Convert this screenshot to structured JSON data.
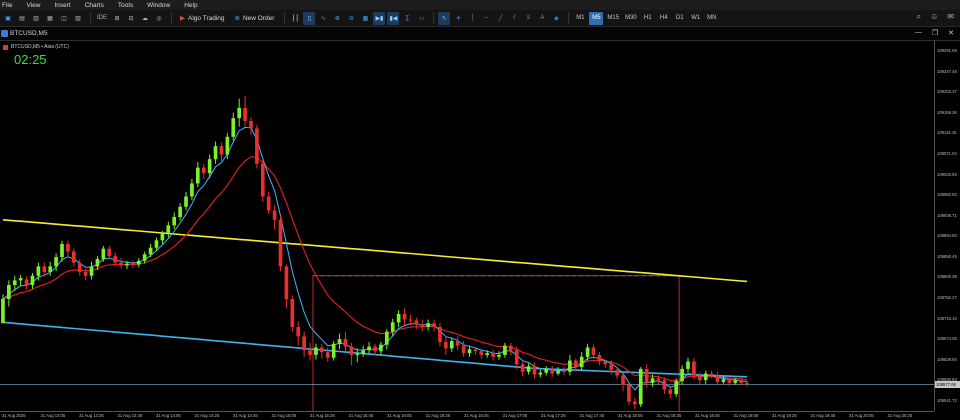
{
  "menu": [
    "File",
    "View",
    "Insert",
    "Charts",
    "Tools",
    "Window",
    "Help"
  ],
  "toolbar": {
    "algo_trading": "Algo Trading",
    "new_order": "New Order",
    "ide": "IDE",
    "timeframes": [
      "M1",
      "M5",
      "M15",
      "M30",
      "H1",
      "H4",
      "D1",
      "W1",
      "MN"
    ],
    "active_timeframe": "M5"
  },
  "chart": {
    "window_title": "BTCUSD,M5",
    "indicator_label": "BTCUSD,M5 ▪ Asia (UTC)",
    "countdown": "02:25",
    "colors": {
      "bull": "#7df02c",
      "bear": "#e8302f",
      "ma_fast": "#3fb5ff",
      "ma_mid": "#d91f1f",
      "ma_slow_yellow": "#f2ef32",
      "ma_slow_blue": "#3ab4ef",
      "box": "#c02a2a",
      "dashed": "#4d6d9a",
      "hline": "#8ab2d6"
    }
  },
  "chart_data": {
    "type": "candlestick",
    "symbol": "BTCUSD",
    "timeframe": "M5",
    "price_ticks": [
      "109291.59",
      "109247.48",
      "109203.37",
      "109159.26",
      "109115.15",
      "109071.04",
      "109026.93",
      "108982.82",
      "108938.71",
      "108894.60",
      "108850.49",
      "108806.38",
      "108762.27",
      "108718.16",
      "108674.05",
      "108629.94",
      "108585.83",
      "108541.72"
    ],
    "current_price": "108577.06",
    "time_ticks": [
      "31 Aug 2025",
      "31 Aug 13:05",
      "31 Aug 13:25",
      "31 Aug 13:45",
      "31 Aug 14:05",
      "31 Aug 14:25",
      "31 Aug 14:45",
      "31 Aug 15:05",
      "31 Aug 15:25",
      "31 Aug 15:45",
      "31 Aug 16:05",
      "31 Aug 16:25",
      "31 Aug 16:45",
      "31 Aug 17:05",
      "31 Aug 17:25",
      "31 Aug 17:45",
      "31 Aug 18:05",
      "31 Aug 18:25",
      "31 Aug 18:45",
      "31 Aug 19:05",
      "31 Aug 19:25",
      "31 Aug 19:45",
      "31 Aug 20:05",
      "31 Aug 20:25"
    ],
    "candles": [
      [
        108708,
        108760,
        108710,
        108770
      ],
      [
        108760,
        108790,
        108744,
        108800
      ],
      [
        108790,
        108800,
        108778,
        108810
      ],
      [
        108800,
        108805,
        108788,
        108812
      ],
      [
        108802,
        108790,
        108780,
        108808
      ],
      [
        108790,
        108810,
        108782,
        108816
      ],
      [
        108810,
        108830,
        108800,
        108838
      ],
      [
        108830,
        108818,
        108808,
        108838
      ],
      [
        108818,
        108830,
        108810,
        108840
      ],
      [
        108830,
        108850,
        108820,
        108858
      ],
      [
        108850,
        108878,
        108840,
        108885
      ],
      [
        108878,
        108862,
        108850,
        108885
      ],
      [
        108862,
        108838,
        108830,
        108868
      ],
      [
        108838,
        108818,
        108810,
        108845
      ],
      [
        108818,
        108810,
        108800,
        108825
      ],
      [
        108810,
        108830,
        108802,
        108840
      ],
      [
        108830,
        108846,
        108822,
        108852
      ],
      [
        108846,
        108868,
        108840,
        108874
      ],
      [
        108868,
        108852,
        108846,
        108874
      ],
      [
        108852,
        108838,
        108830,
        108860
      ],
      [
        108838,
        108832,
        108826,
        108848
      ],
      [
        108832,
        108836,
        108824,
        108842
      ],
      [
        108836,
        108834,
        108826,
        108842
      ],
      [
        108834,
        108842,
        108828,
        108848
      ],
      [
        108842,
        108856,
        108836,
        108862
      ],
      [
        108856,
        108870,
        108850,
        108878
      ],
      [
        108870,
        108886,
        108864,
        108892
      ],
      [
        108886,
        108900,
        108878,
        108906
      ],
      [
        108900,
        108918,
        108892,
        108926
      ],
      [
        108918,
        108936,
        108910,
        108946
      ],
      [
        108936,
        108958,
        108928,
        108966
      ],
      [
        108958,
        108980,
        108950,
        108990
      ],
      [
        108980,
        109008,
        108972,
        109018
      ],
      [
        109008,
        109042,
        109000,
        109054
      ],
      [
        109042,
        109030,
        109018,
        109050
      ],
      [
        109030,
        109060,
        109020,
        109070
      ],
      [
        109060,
        109088,
        109050,
        109098
      ],
      [
        109088,
        109070,
        109056,
        109096
      ],
      [
        109070,
        109108,
        109060,
        109116
      ],
      [
        109108,
        109148,
        109100,
        109160
      ],
      [
        109148,
        109170,
        109130,
        109190
      ],
      [
        109170,
        109142,
        109130,
        109196
      ],
      [
        109142,
        109126,
        109112,
        109150
      ],
      [
        109126,
        109050,
        109040,
        109134
      ],
      [
        109050,
        108980,
        108968,
        109058
      ],
      [
        108980,
        108950,
        108942,
        108990
      ],
      [
        108950,
        108930,
        108910,
        108962
      ],
      [
        108930,
        108830,
        108820,
        108938
      ],
      [
        108830,
        108760,
        108740,
        108834
      ],
      [
        108760,
        108700,
        108690,
        108768
      ],
      [
        108700,
        108680,
        108660,
        108712
      ],
      [
        108680,
        108650,
        108636,
        108690
      ],
      [
        108650,
        108640,
        108628,
        108666
      ],
      [
        108640,
        108656,
        108630,
        108664
      ],
      [
        108656,
        108646,
        108632,
        108664
      ],
      [
        108646,
        108634,
        108625,
        108656
      ],
      [
        108634,
        108664,
        108628,
        108670
      ],
      [
        108664,
        108674,
        108652,
        108686
      ],
      [
        108674,
        108658,
        108648,
        108690
      ],
      [
        108658,
        108640,
        108618,
        108666
      ],
      [
        108640,
        108642,
        108624,
        108654
      ],
      [
        108642,
        108650,
        108636,
        108660
      ],
      [
        108650,
        108658,
        108642,
        108668
      ],
      [
        108658,
        108648,
        108640,
        108664
      ],
      [
        108648,
        108662,
        108640,
        108668
      ],
      [
        108662,
        108690,
        108652,
        108696
      ],
      [
        108690,
        108710,
        108680,
        108718
      ],
      [
        108710,
        108728,
        108700,
        108736
      ],
      [
        108728,
        108716,
        108704,
        108740
      ],
      [
        108716,
        108714,
        108704,
        108726
      ],
      [
        108714,
        108706,
        108696,
        108720
      ],
      [
        108706,
        108700,
        108690,
        108716
      ],
      [
        108700,
        108708,
        108692,
        108716
      ],
      [
        108708,
        108700,
        108690,
        108716
      ],
      [
        108700,
        108668,
        108658,
        108708
      ],
      [
        108668,
        108654,
        108640,
        108680
      ],
      [
        108654,
        108670,
        108646,
        108676
      ],
      [
        108670,
        108660,
        108650,
        108680
      ],
      [
        108660,
        108644,
        108636,
        108670
      ],
      [
        108644,
        108652,
        108636,
        108660
      ],
      [
        108652,
        108648,
        108640,
        108656
      ],
      [
        108648,
        108640,
        108632,
        108654
      ],
      [
        108640,
        108644,
        108634,
        108650
      ],
      [
        108644,
        108636,
        108628,
        108652
      ],
      [
        108636,
        108640,
        108630,
        108648
      ],
      [
        108640,
        108660,
        108634,
        108666
      ],
      [
        108660,
        108650,
        108640,
        108666
      ],
      [
        108650,
        108620,
        108610,
        108658
      ],
      [
        108620,
        108604,
        108594,
        108626
      ],
      [
        108604,
        108616,
        108598,
        108622
      ],
      [
        108616,
        108598,
        108590,
        108624
      ],
      [
        108598,
        108602,
        108592,
        108608
      ],
      [
        108602,
        108610,
        108596,
        108616
      ],
      [
        108610,
        108600,
        108592,
        108616
      ],
      [
        108600,
        108606,
        108596,
        108614
      ],
      [
        108606,
        108604,
        108596,
        108614
      ],
      [
        108604,
        108628,
        108596,
        108640
      ],
      [
        108628,
        108614,
        108604,
        108632
      ],
      [
        108614,
        108636,
        108606,
        108646
      ],
      [
        108636,
        108656,
        108628,
        108664
      ],
      [
        108656,
        108640,
        108632,
        108662
      ],
      [
        108640,
        108626,
        108618,
        108646
      ],
      [
        108626,
        108620,
        108612,
        108630
      ],
      [
        108620,
        108608,
        108598,
        108628
      ],
      [
        108608,
        108596,
        108588,
        108614
      ],
      [
        108596,
        108576,
        108562,
        108602
      ],
      [
        108576,
        108540,
        108532,
        108580
      ],
      [
        108540,
        108534,
        108524,
        108548
      ],
      [
        108534,
        108610,
        108528,
        108614
      ],
      [
        108610,
        108580,
        108570,
        108620
      ],
      [
        108580,
        108590,
        108572,
        108598
      ],
      [
        108590,
        108586,
        108578,
        108596
      ],
      [
        108586,
        108566,
        108556,
        108592
      ],
      [
        108566,
        108556,
        108546,
        108570
      ],
      [
        108556,
        108584,
        108550,
        108590
      ],
      [
        108584,
        108610,
        108576,
        108618
      ],
      [
        108610,
        108626,
        108602,
        108634
      ],
      [
        108626,
        108596,
        108588,
        108634
      ],
      [
        108596,
        108586,
        108578,
        108602
      ],
      [
        108586,
        108600,
        108578,
        108606
      ],
      [
        108600,
        108596,
        108590,
        108606
      ],
      [
        108596,
        108582,
        108576,
        108604
      ],
      [
        108582,
        108588,
        108578,
        108594
      ],
      [
        108588,
        108580,
        108574,
        108594
      ],
      [
        108580,
        108586,
        108576,
        108590
      ],
      [
        108586,
        108580,
        108574,
        108592
      ],
      [
        108580,
        108578,
        108572,
        108586
      ]
    ]
  }
}
